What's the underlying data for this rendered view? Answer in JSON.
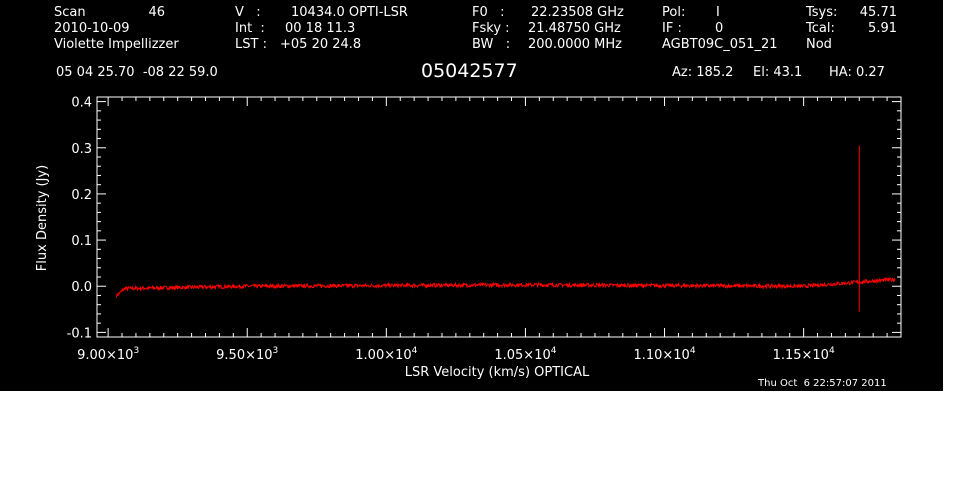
{
  "header": {
    "scan_label": "Scan",
    "scan_value": "46",
    "date": "2010-10-09",
    "observer": "Violette Impellizzer",
    "v_label": "V   :",
    "v_value": "10434.0 OPTI-LSR",
    "int_label": "Int  :",
    "int_value": "00 18 11.3",
    "lst_label": "LST :",
    "lst_value": "+05 20 24.8",
    "f0_label": "F0   :",
    "f0_value": "22.23508 GHz",
    "fsky_label": "Fsky :",
    "fsky_value": "21.48750 GHz",
    "bw_label": "BW   :",
    "bw_value": "200.0000 MHz",
    "pol_label": "Pol:",
    "pol_value": "I",
    "if_label": "IF :",
    "if_value": "0",
    "project": "AGBT09C_051_21",
    "tsys_label": "Tsys:",
    "tsys_value": "45.71",
    "tcal_label": "Tcal:",
    "tcal_value": "5.91",
    "mode": "Nod",
    "coords": "05 04 25.70  -08 22 59.0",
    "source": "05042577",
    "az": "Az: 185.2",
    "el": "El: 43.1",
    "ha": "HA: 0.27",
    "timestamp": "Thu Oct  6 22:57:07 2011"
  },
  "chart_data": {
    "type": "line",
    "xlabel": "LSR Velocity (km/s) OPTICAL",
    "ylabel": "Flux Density (Jy)",
    "xlim": [
      8960,
      11850
    ],
    "ylim": [
      -0.11,
      0.41
    ],
    "x_ticks": [
      9000,
      9500,
      10000,
      10500,
      11000,
      11500
    ],
    "x_tick_labels": [
      {
        "mant": "9.00×10",
        "exp": "3"
      },
      {
        "mant": "9.50×10",
        "exp": "3"
      },
      {
        "mant": "1.00×10",
        "exp": "4"
      },
      {
        "mant": "1.05×10",
        "exp": "4"
      },
      {
        "mant": "1.10×10",
        "exp": "4"
      },
      {
        "mant": "1.15×10",
        "exp": "4"
      }
    ],
    "y_ticks": [
      -0.1,
      0.0,
      0.1,
      0.2,
      0.3,
      0.4
    ],
    "y_tick_labels": [
      "-0.1",
      "0.0",
      "0.1",
      "0.2",
      "0.3",
      "0.4"
    ],
    "series": [
      {
        "color": "#ff0000",
        "x_range": [
          9030,
          11830
        ],
        "baseline": [
          [
            9030,
            -0.02
          ],
          [
            9060,
            -0.005
          ],
          [
            9500,
            0.0
          ],
          [
            10500,
            0.003
          ],
          [
            11500,
            0.0
          ],
          [
            11830,
            0.015
          ]
        ],
        "noise_amplitude": 0.004,
        "spike": {
          "x": 11700,
          "peak": 0.305,
          "dip": -0.055
        }
      }
    ]
  }
}
